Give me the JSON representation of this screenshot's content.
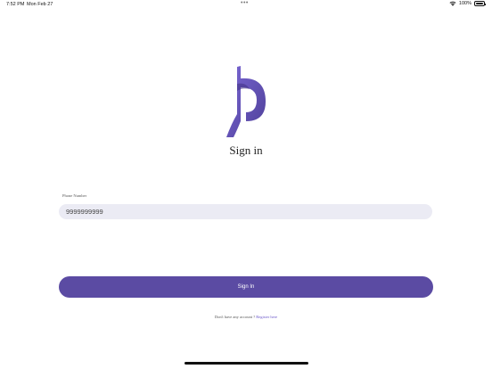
{
  "status_bar": {
    "time": "7:52 PM",
    "date": "Mon Feb 27",
    "dots": "•••",
    "wifi_icon": "wifi-icon",
    "battery_percent": "100%",
    "battery_level": 1.0
  },
  "logo": {
    "icon": "brand-logo-icon",
    "color": "#6a56c9"
  },
  "title": "Sign in",
  "phone": {
    "label": "Phone Number",
    "value": "9999999999"
  },
  "signin_button": {
    "label": "Sign In",
    "color": "#5b4ba3"
  },
  "register": {
    "prompt": "Don't have any account ?",
    "link": "Register here",
    "link_color": "#6a56c9"
  }
}
